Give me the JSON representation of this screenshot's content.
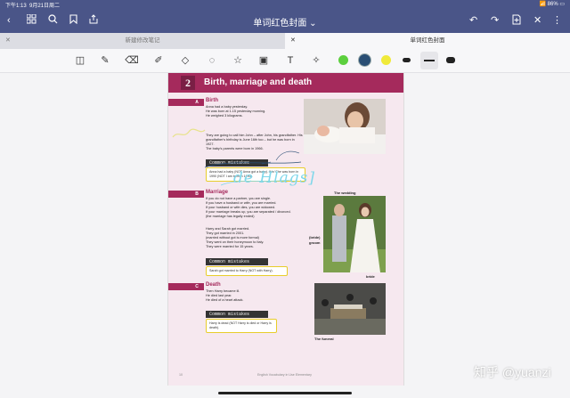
{
  "status": {
    "time": "下午1:13",
    "date": "9月21日周二",
    "battery": "86%"
  },
  "nav": {
    "title": "单词红色封面 ⌄"
  },
  "tabs": [
    {
      "label": "新建修改笔记"
    },
    {
      "label": "单词红色封面"
    }
  ],
  "colors": {
    "brand": "#4a5588",
    "accent": "#a52a5c",
    "green": "#5ccf3e",
    "yellow": "#f0ea3a",
    "highlight": "#e8cd2a"
  },
  "page": {
    "unit_number": "2",
    "unit_title": "Birth, marriage and death",
    "A": {
      "letter": "A",
      "title": "Birth",
      "text1": "Anna had a baby yesterday.\nHe was born at 1.15 yesterday morning.\nHe weighed 3 kilograms.",
      "text2": "They are going to call him John – after John, his grandfather. His grandfather's birthday is June 16th too – but he was born in 1927.\nThe baby's parents were born in 1966.",
      "mistakes_label": "Common mistakes",
      "mistake_text": "Anna had a baby (NOT Anna got a baby).\nWe/ She was born in 1990 (NOT I am born in 1990)."
    },
    "B": {
      "letter": "B",
      "title": "Marriage",
      "text1": "If you do not have a partner, you are single.\nIf you have a husband or wife, you are married.\nIf your husband or wife dies, you are widowed.\nIf your marriage breaks up, you are separated / divorced.\n(the marriage has legally ended)",
      "text2": "Harry and Sarah got married.\nThey got married in 2001.\n(married without got is more formal)\nThey went on their honeymoon to Italy.\nThey were married for 15 years.",
      "mistakes_label": "Common mistakes",
      "mistake_text": "Sarah got married to Harry (NOT with Harry).",
      "caption_wedding": "The wedding",
      "caption_bride": "(bride)",
      "caption_groom": "groom",
      "caption_bride2": "bride"
    },
    "C": {
      "letter": "C",
      "title": "Death",
      "text1": "Then Harry became ill.\nHe died last year.\nHe died of a heart attack.",
      "mistakes_label": "Common mistakes",
      "mistake_text": "Harry is dead (NOT Harry is died or Harry is death).",
      "caption_funeral": "The funeral"
    },
    "footer_page": "10",
    "footer_title": "English Vocabulary in Use Elementary"
  },
  "annotations": {
    "handwriting": "de Hlags]"
  },
  "watermark": "知乎 @yuanzi"
}
